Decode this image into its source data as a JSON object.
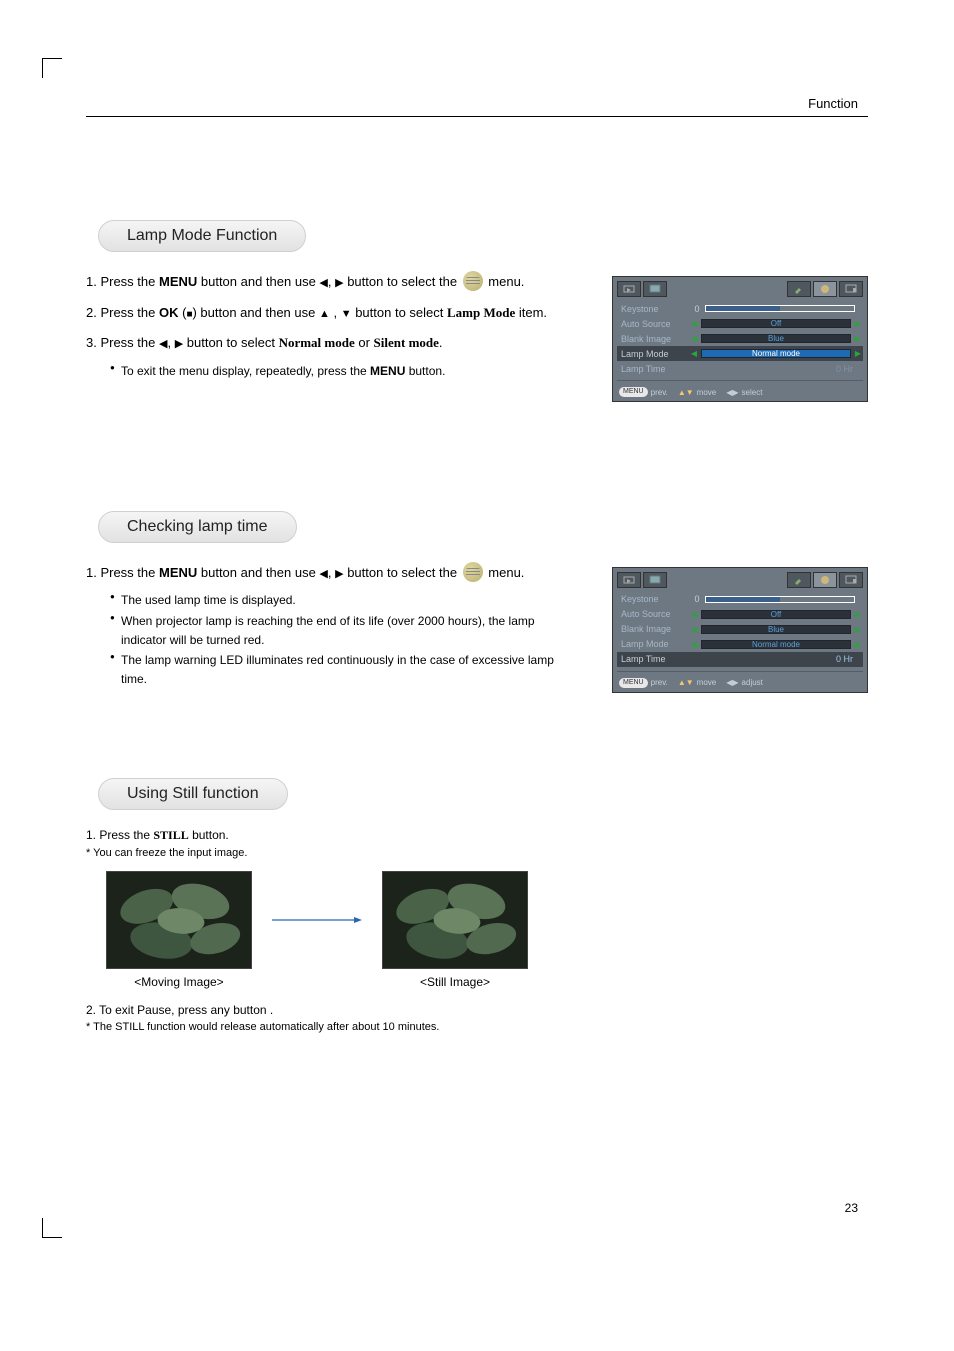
{
  "header": {
    "label": "Function"
  },
  "page_number": "23",
  "sections": {
    "lamp_mode": {
      "title": "Lamp Mode Function",
      "step1_a": "1. Press the ",
      "menu_word": "MENU",
      "step1_b": " button and then use ",
      "step1_c": " button to select the ",
      "step1_d": " menu.",
      "step2_a": "2. Press the ",
      "ok_word": "OK",
      "step2_b": " (",
      "step2_c": ") button and then use ",
      "step2_d": " button to select ",
      "lamp_mode_word": "Lamp Mode",
      "step2_e": " item.",
      "step3_a": "3. Press the ",
      "step3_b": " button to select ",
      "normal_word": "Normal mode",
      "or_word": " or ",
      "silent_word": "Silent mode",
      "step3_c": ".",
      "bullet1": "To exit the menu display, repeatedly, press the ",
      "bullet1_end": " button."
    },
    "check_lamp": {
      "title": "Checking lamp time",
      "step1_a": "1. Press the ",
      "menu_word": "MENU",
      "step1_b": " button and then use ",
      "step1_c": " button to select the ",
      "step1_d": " menu.",
      "bullet1": "The used lamp time is displayed.",
      "bullet2": "When projector lamp is reaching the end of its life (over 2000 hours), the lamp indicator will be turned red.",
      "bullet3": "The lamp warning LED illuminates red continuously in the case of excessive lamp time."
    },
    "still": {
      "title": "Using Still function",
      "step1_a": "1. Press the ",
      "still_word": "STILL",
      "step1_b": " button.",
      "note1": "* You can freeze the input image.",
      "cap_moving": "<Moving Image>",
      "cap_still": "<Still Image>",
      "step2": "2. To exit Pause, press any button .",
      "note2": "* The STILL function would release automatically after about 10 minutes."
    }
  },
  "osd1": {
    "rows": {
      "keystone": "Keystone",
      "keystone_val": "0",
      "auto_source": "Auto Source",
      "auto_source_val": "Off",
      "blank_image": "Blank Image",
      "blank_image_val": "Blue",
      "lamp_mode": "Lamp Mode",
      "lamp_mode_val": "Normal mode",
      "lamp_time": "Lamp Time",
      "lamp_time_val": "0 Hr"
    },
    "hints": {
      "menu": "MENU",
      "prev": "prev.",
      "move": "move",
      "select": "select"
    }
  },
  "osd2": {
    "rows": {
      "keystone": "Keystone",
      "keystone_val": "0",
      "auto_source": "Auto Source",
      "auto_source_val": "Off",
      "blank_image": "Blank Image",
      "blank_image_val": "Blue",
      "lamp_mode": "Lamp Mode",
      "lamp_mode_val": "Normal mode",
      "lamp_time": "Lamp Time",
      "lamp_time_val": "0 Hr"
    },
    "hints": {
      "menu": "MENU",
      "prev": "prev.",
      "move": "move",
      "adjust": "adjust"
    }
  }
}
